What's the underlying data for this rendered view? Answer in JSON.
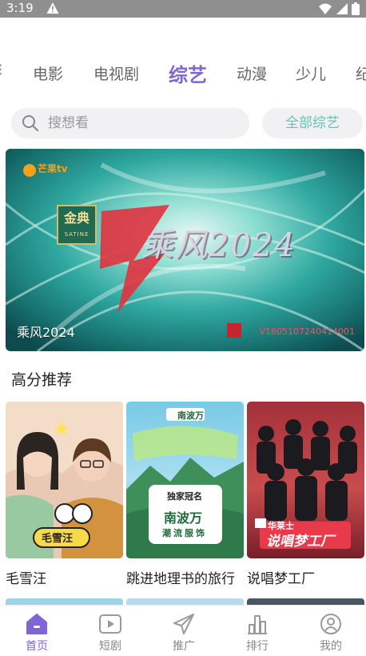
{
  "status_bar": {
    "time": "3:19"
  },
  "tabs": {
    "items": [
      {
        "label": "电影",
        "active": false
      },
      {
        "label": "电视剧",
        "active": false
      },
      {
        "label": "综艺",
        "active": true
      },
      {
        "label": "动漫",
        "active": false
      },
      {
        "label": "少儿",
        "active": false
      }
    ]
  },
  "search": {
    "placeholder": "搜想看",
    "all_button": "全部综艺"
  },
  "banner": {
    "channel": "芒果tv",
    "sponsor": "金典",
    "sponsor_sub": "SATINE",
    "show_logo": "乘风2024",
    "caption": "乘风2024",
    "code": "V1805107240414001"
  },
  "section": {
    "title": "高分推荐",
    "cards": [
      {
        "title": "毛雪汪",
        "thumb_text": "毛雪汪"
      },
      {
        "title": "跳进地理书的旅行",
        "thumb_text": "南波万",
        "thumb_badge": "独家冠名",
        "thumb_sub": "潮流服饰"
      },
      {
        "title": "说唱梦工厂",
        "thumb_text": "说唱梦工厂",
        "thumb_brand": "华莱士"
      }
    ]
  },
  "bottom_nav": {
    "items": [
      {
        "label": "首页",
        "icon": "home-icon",
        "active": true
      },
      {
        "label": "短剧",
        "icon": "play-icon",
        "active": false
      },
      {
        "label": "推广",
        "icon": "paper-plane-icon",
        "active": false
      },
      {
        "label": "排行",
        "icon": "bar-chart-icon",
        "active": false
      },
      {
        "label": "我的",
        "icon": "user-icon",
        "active": false
      }
    ]
  },
  "colors": {
    "accent": "#7f66d6",
    "teal": "#63c5b7",
    "status_bar": "#8f8f8f"
  }
}
